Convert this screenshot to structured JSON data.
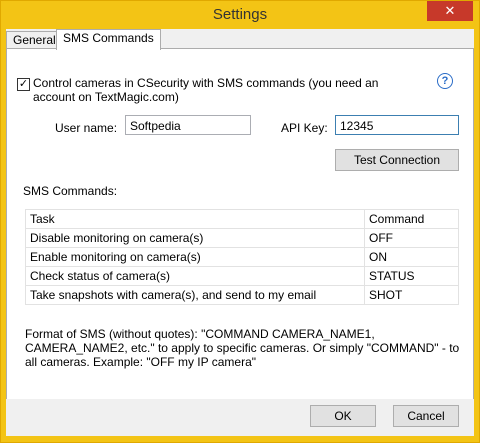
{
  "window": {
    "title": "Settings",
    "close_glyph": "✕"
  },
  "tabs": [
    {
      "label": "General",
      "active": false
    },
    {
      "label": "SMS Commands",
      "active": true
    }
  ],
  "sms": {
    "enable_checkbox_label": "Control cameras in CSecurity with SMS commands (you need an account on TextMagic.com)",
    "enable_checked": true,
    "help_glyph": "?",
    "username_label": "User name:",
    "username_value": "Softpedia",
    "apikey_label": "API Key:",
    "apikey_value": "12345",
    "test_button": "Test Connection",
    "commands_label": "SMS Commands:",
    "table": {
      "headers": [
        "Task",
        "Command"
      ],
      "rows": [
        [
          "Disable monitoring on camera(s)",
          "OFF"
        ],
        [
          "Enable monitoring on camera(s)",
          "ON"
        ],
        [
          "Check status of camera(s)",
          "STATUS"
        ],
        [
          "Take snapshots with camera(s), and send to my email",
          "SHOT"
        ]
      ]
    },
    "format_note": "Format of SMS (without quotes): \"COMMAND CAMERA_NAME1, CAMERA_NAME2, etc.\"  to apply to specific cameras. Or simply \"COMMAND\" - to all cameras. Example: \"OFF my IP camera\""
  },
  "footer": {
    "ok": "OK",
    "cancel": "Cancel"
  }
}
